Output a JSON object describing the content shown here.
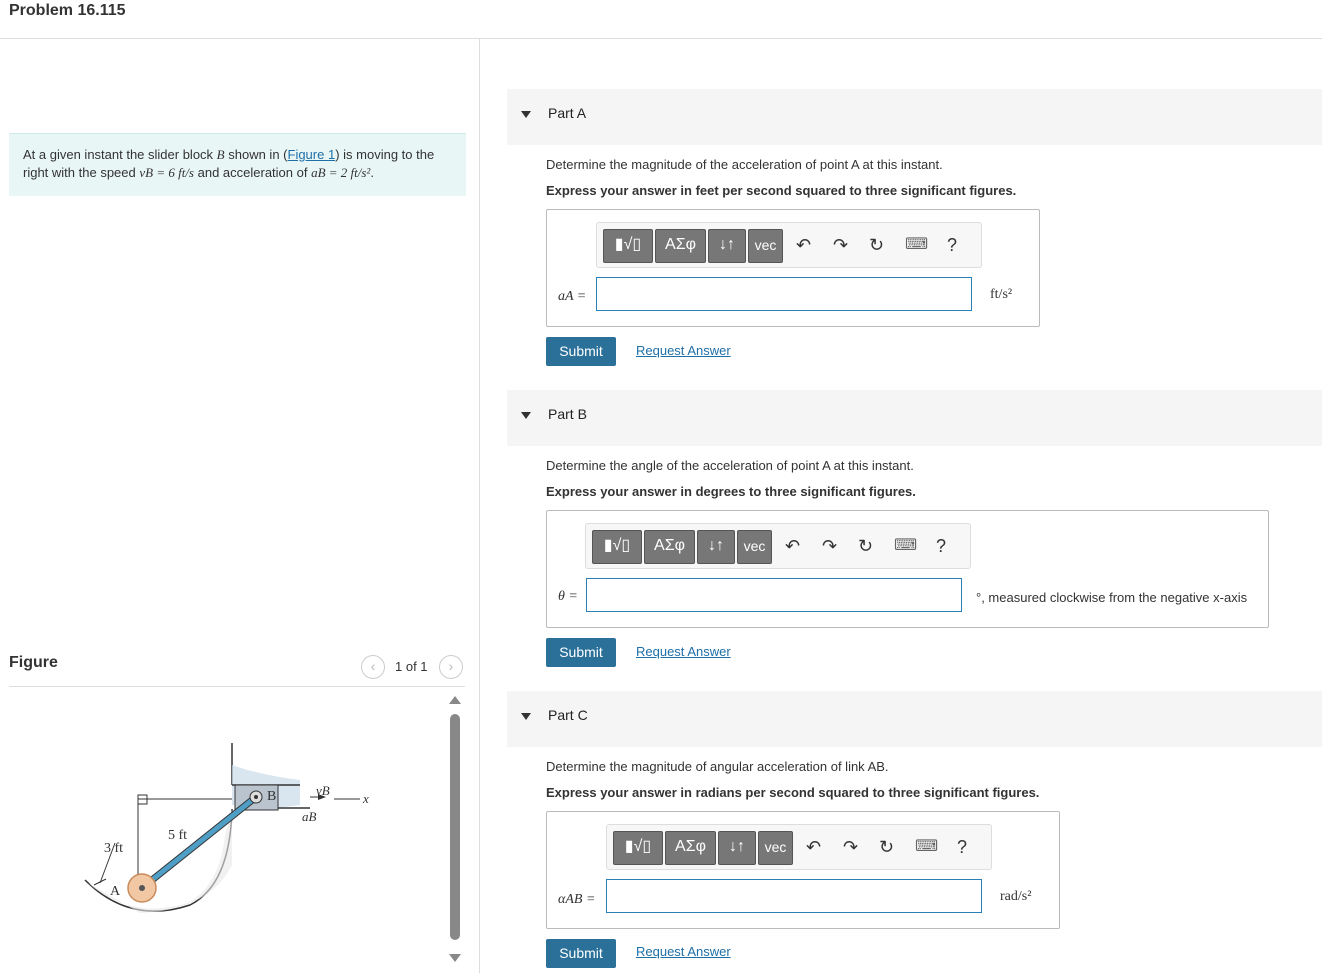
{
  "header": {
    "title": "Problem 16.115"
  },
  "problem": {
    "text_1": "At a given instant the slider block ",
    "var_b": "B",
    "text_2": " shown in (",
    "figure_link": "Figure 1",
    "text_3": ") is moving to the right with the speed ",
    "speed_expr": "vB = 6 ft/s",
    "text_4": " and acceleration of ",
    "accel_expr": "aB = 2 ft/s²",
    "text_5": "."
  },
  "figure_panel": {
    "label": "Figure",
    "page_indicator": "1 of 1",
    "prev_icon": "chevron-left-icon",
    "next_icon": "chevron-right-icon",
    "figure_labels": {
      "b": "B",
      "a": "A",
      "vb": "vB",
      "ab": "aB",
      "x": "x",
      "len_5": "5 ft",
      "len_3": "3 ft"
    }
  },
  "toolbar": {
    "templates_label": "▮√▯",
    "greek_label": "ΑΣφ",
    "arrows_label": "↓↑",
    "vec_label": "vec",
    "undo_icon": "undo-icon",
    "redo_icon": "redo-icon",
    "reset_icon": "reset-icon",
    "keyboard_icon": "keyboard-icon",
    "help_label": "?"
  },
  "parts": [
    {
      "label": "Part A",
      "question": "Determine the magnitude of the acceleration of point A at this instant.",
      "instruction": "Express your answer in feet per second squared to three significant figures.",
      "variable": "aA =",
      "value": "",
      "unit": "ft/s²",
      "submit_label": "Submit",
      "request_label": "Request Answer"
    },
    {
      "label": "Part B",
      "question": "Determine the angle of the acceleration of point A at this instant.",
      "instruction": "Express your answer in degrees to three significant figures.",
      "variable": "θ =",
      "value": "",
      "unit": "°, measured clockwise from the negative x-axis",
      "submit_label": "Submit",
      "request_label": "Request Answer"
    },
    {
      "label": "Part C",
      "question": "Determine the magnitude of angular acceleration of link AB.",
      "instruction": "Express your answer in radians per second squared to three significant figures.",
      "variable": "αAB =",
      "value": "",
      "unit": "rad/s²",
      "submit_label": "Submit",
      "request_label": "Request Answer"
    }
  ]
}
